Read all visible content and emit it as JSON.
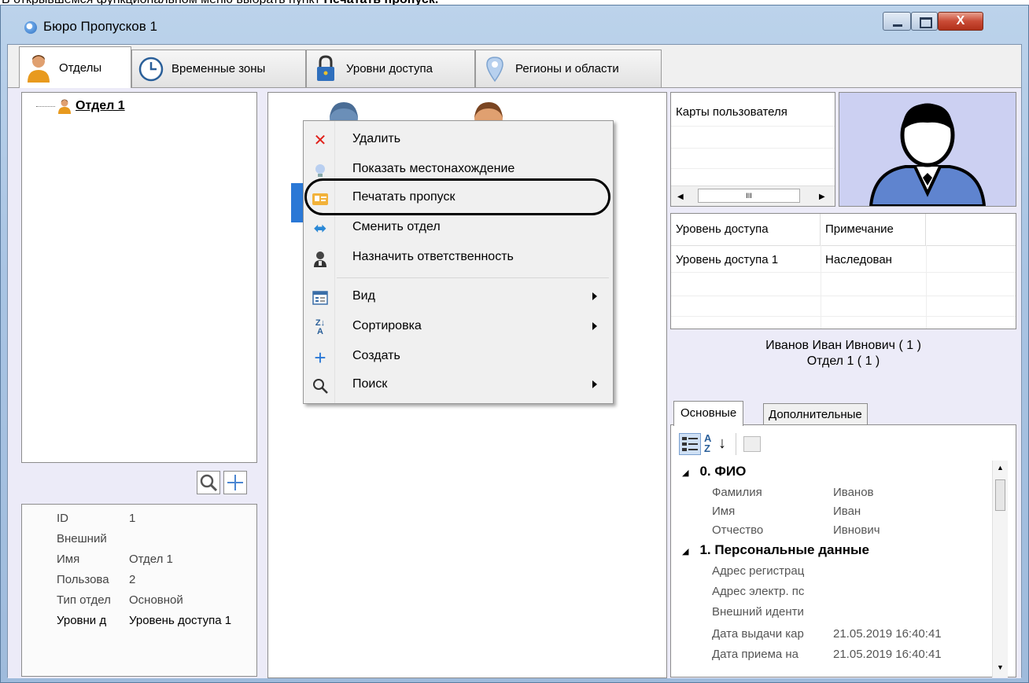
{
  "caption": {
    "prefix": "В открывшемся функциональном меню выбрать пункт ",
    "bold": "Печатать пропуск."
  },
  "window": {
    "title": "Бюро Пропусков 1",
    "close_label": "X"
  },
  "tabs": [
    {
      "label": "Отделы",
      "icon": "user-icon"
    },
    {
      "label": "Временные зоны",
      "icon": "clock-icon"
    },
    {
      "label": "Уровни доступа",
      "icon": "padlock-icon"
    },
    {
      "label": "Регионы и области",
      "icon": "map-pin-icon"
    }
  ],
  "tree": {
    "root": "Отдел 1"
  },
  "dept_props": {
    "rows": [
      {
        "key": "ID",
        "value": "1"
      },
      {
        "key": "Внешний",
        "value": ""
      },
      {
        "key": "Имя",
        "value": "Отдел 1"
      },
      {
        "key": "Пользова",
        "value": "2"
      },
      {
        "key": "Тип отдел",
        "value": "Основной"
      },
      {
        "key": "Уровни д",
        "value": "Уровень доступа 1"
      }
    ]
  },
  "context_menu": {
    "items": [
      {
        "label": "Удалить",
        "icon": "delete-x-icon"
      },
      {
        "label": "Показать местонахождение",
        "icon": "location-bulb-icon"
      },
      {
        "label": "Печатать пропуск",
        "icon": "print-pass-icon"
      },
      {
        "label": "Сменить отдел",
        "icon": "swap-arrows-icon"
      },
      {
        "label": "Назначить ответственность",
        "icon": "assign-person-icon"
      },
      {
        "label": "Вид",
        "icon": "view-icon",
        "submenu": true
      },
      {
        "label": "Сортировка",
        "icon": "sort-az-icon",
        "submenu": true
      },
      {
        "label": "Создать",
        "icon": "plus-icon"
      },
      {
        "label": "Поиск",
        "icon": "search-icon",
        "submenu": true
      }
    ]
  },
  "cards": {
    "header": "Карты пользователя",
    "scroll_mark": "III"
  },
  "access": {
    "headers": [
      "Уровень доступа",
      "Примечание"
    ],
    "rows": [
      [
        "Уровень доступа 1",
        "Наследован"
      ]
    ]
  },
  "user": {
    "name": "Иванов Иван Ивнович ( 1 )",
    "dept": "Отдел 1 ( 1 )"
  },
  "subtabs": [
    "Основные",
    "Дополнительные"
  ],
  "props": {
    "categories": [
      {
        "title": "0. ФИО",
        "rows": [
          [
            "Фамилия",
            "Иванов"
          ],
          [
            "Имя",
            "Иван"
          ],
          [
            "Отчество",
            "Ивнович"
          ]
        ]
      },
      {
        "title": "1. Персональные данные",
        "rows": [
          [
            "Адрес регистрац",
            ""
          ],
          [
            "Адрес электр. пс",
            ""
          ],
          [
            "Внешний иденти",
            ""
          ],
          [
            "Дата выдачи кар",
            "21.05.2019 16:40:41"
          ],
          [
            "Дата приема на",
            "21.05.2019 16:40:41"
          ]
        ]
      }
    ]
  },
  "colors": {
    "accent": "#2a78d6",
    "panel_bg": "#ecebf8",
    "photo_bg": "#ccd0f2",
    "close_red": "#c94b36"
  }
}
